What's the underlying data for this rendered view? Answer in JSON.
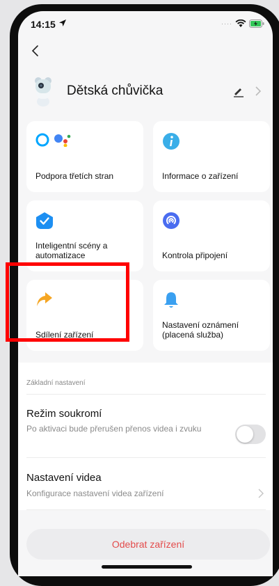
{
  "status": {
    "time": "14:15"
  },
  "device": {
    "name": "Dětská chůvička"
  },
  "tiles": [
    {
      "label": "Podpora třetích stran"
    },
    {
      "label": "Informace o zařízení"
    },
    {
      "label": "Inteligentní scény a automatizace"
    },
    {
      "label": "Kontrola připojení"
    },
    {
      "label": "Sdílení zařízení"
    },
    {
      "label": "Nastavení oznámení (placená služba)"
    }
  ],
  "settings": {
    "section_title": "Základní nastavení",
    "privacy": {
      "title": "Režim soukromí",
      "description": "Po aktivaci bude přerušen přenos videa i zvuku",
      "enabled": false
    },
    "video": {
      "title": "Nastavení videa",
      "description": "Konfigurace nastavení videa zařízení"
    }
  },
  "remove_button": "Odebrat zařízení",
  "colors": {
    "accent_blue": "#1d6ff2",
    "alexa": "#00a6ff",
    "orange": "#f5a623",
    "danger": "#e34b4b",
    "highlight": "#ff0000"
  },
  "icons": [
    "back-icon",
    "edit-icon",
    "chevron-right-icon",
    "alexa-icon",
    "google-assistant-icon",
    "info-icon",
    "smart-scene-icon",
    "connection-icon",
    "share-icon",
    "bell-icon"
  ]
}
